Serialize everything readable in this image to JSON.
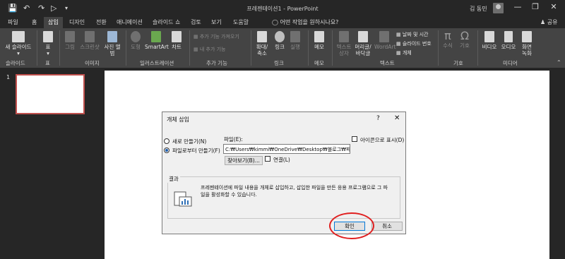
{
  "titlebar": {
    "title": "프레젠테이션1 - PowerPoint",
    "user": "김 동민",
    "minimize": "—",
    "restore": "❐",
    "close": "✕"
  },
  "tabs": [
    "파일",
    "홈",
    "삽입",
    "디자인",
    "전환",
    "애니메이션",
    "슬라이드 쇼",
    "검토",
    "보기",
    "도움말"
  ],
  "active_tab": "삽입",
  "tell_me": "어떤 작업을 원하시나요?",
  "share": "공유",
  "ribbon": {
    "new_slide": "새 슬라이드",
    "table": "표",
    "picture": "그림",
    "screenshot": "스크린샷",
    "photo_album": "사진 앨범",
    "shapes": "도형",
    "smartart": "SmartArt",
    "chart": "차트",
    "get_addins": "추가 기능 가져오기",
    "my_addins": "내 추가 기능",
    "zoom": "확대/ 축소",
    "link": "링크",
    "action": "실행",
    "comment": "메모",
    "textbox": "텍스트 상자",
    "header_footer": "머리글/ 바닥글",
    "wordart": "WordArt",
    "date_time": "날짜 및 시간",
    "slide_number": "슬라이드 번호",
    "object": "개체",
    "equation": "수식",
    "symbol": "기호",
    "video": "비디오",
    "audio": "오디오",
    "screen_recording": "화면 녹화",
    "groups": {
      "slides": "슬라이드",
      "tables": "표",
      "images": "이미지",
      "illustrations": "일러스트레이션",
      "addins": "추가 기능",
      "links": "링크",
      "comments": "메모",
      "text": "텍스트",
      "symbols": "기호",
      "media": "미디어"
    }
  },
  "slide_panel": {
    "slide_number": "1"
  },
  "dialog": {
    "title": "개체 삽입",
    "help": "?",
    "close": "✕",
    "create_new": "새로 만들기(N)",
    "create_from_file": "파일로부터 만들기(F)",
    "file_label": "파일(E):",
    "file_path": "C:₩Users₩kimmi₩OneDrive₩Desktop₩블로그₩파워포",
    "browse": "찾아보기(B)...",
    "link": "연결(L)",
    "display_as_icon": "아이콘으로 표시(D)",
    "result_caption": "결과",
    "result_text": "프레젠테이션에 파일 내용을 개체로 삽입하고, 삽입한 파일을 만든 응용 프로그램으로 그 파일을 활성화할 수 있습니다.",
    "ok": "확인",
    "cancel": "취소"
  }
}
